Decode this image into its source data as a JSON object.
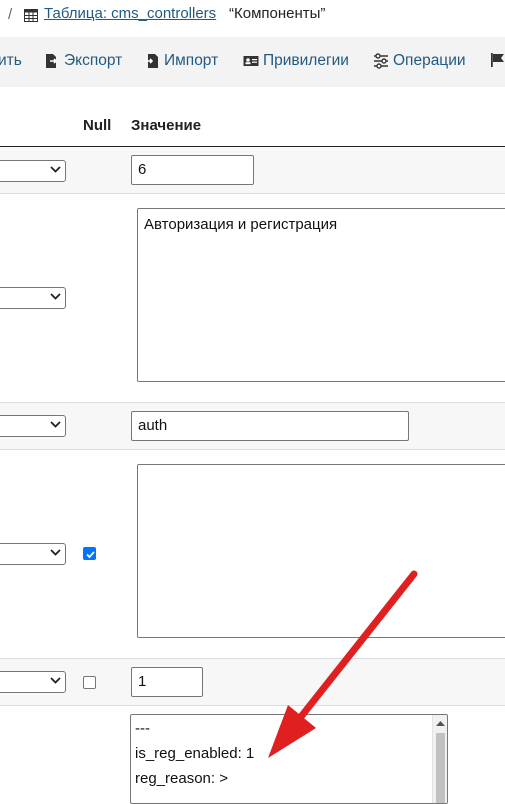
{
  "breadcrumb": {
    "separator": "/",
    "table_link": "Таблица: cms_controllers",
    "table_comment": "“Компоненты”"
  },
  "toolbar": {
    "items": [
      {
        "label": "ить",
        "icon": "edit-icon"
      },
      {
        "label": "Экспорт",
        "icon": "export-icon"
      },
      {
        "label": "Импорт",
        "icon": "import-icon"
      },
      {
        "label": "Привилегии",
        "icon": "privileges-icon"
      },
      {
        "label": "Операции",
        "icon": "operations-icon"
      },
      {
        "label": "",
        "icon": "flag-icon"
      }
    ]
  },
  "columns": {
    "null": "Null",
    "value": "Значение"
  },
  "rows": [
    {
      "value": "6",
      "null_checked": false
    },
    {
      "value": "Авторизация и регистрация",
      "null_checked": false
    },
    {
      "value": "auth",
      "null_checked": false
    },
    {
      "value": "",
      "null_checked": true
    },
    {
      "value": "1",
      "null_checked": false
    },
    {
      "value_lines": [
        "---",
        "is_reg_enabled: 1",
        "reg_reason: >"
      ],
      "null_checked": false
    }
  ],
  "colors": {
    "link": "#235a81",
    "annotation_arrow": "#e02020",
    "checkbox_checked": "#0075ff"
  }
}
